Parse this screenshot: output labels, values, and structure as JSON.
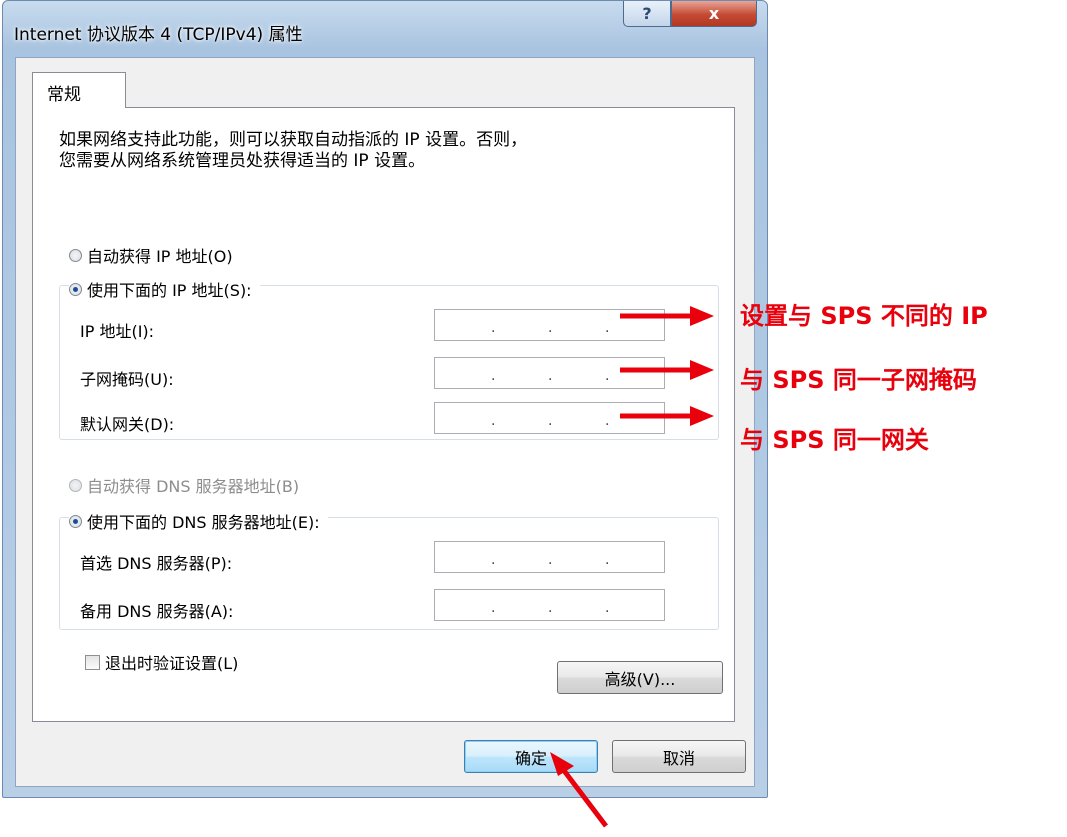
{
  "window": {
    "title": "Internet 协议版本 4 (TCP/IPv4) 属性",
    "help_label": "?",
    "close_label": "x"
  },
  "tabs": [
    {
      "label": "常规",
      "selected": true
    }
  ],
  "info_text": {
    "line1": "如果网络支持此功能，则可以获取自动指派的 IP 设置。否则，",
    "line2": "您需要从网络系统管理员处获得适当的 IP 设置。"
  },
  "ip_section": {
    "auto_option": {
      "label": "自动获得 IP 地址(O)",
      "checked": false
    },
    "manual_option": {
      "label": "使用下面的 IP 地址(S):",
      "checked": true
    },
    "fields": [
      {
        "label": "IP 地址(I):",
        "value": ". . ."
      },
      {
        "label": "子网掩码(U):",
        "value": ". . ."
      },
      {
        "label": "默认网关(D):",
        "value": ". . ."
      }
    ]
  },
  "dns_section": {
    "auto_option": {
      "label": "自动获得 DNS 服务器地址(B)",
      "checked": false,
      "disabled": true
    },
    "manual_option": {
      "label": "使用下面的 DNS 服务器地址(E):",
      "checked": true
    },
    "fields": [
      {
        "label": "首选 DNS 服务器(P):",
        "value": ". . ."
      },
      {
        "label": "备用 DNS 服务器(A):",
        "value": ". . ."
      }
    ]
  },
  "validate_checkbox": {
    "label": "退出时验证设置(L)",
    "checked": false
  },
  "buttons": {
    "advanced": "高级(V)...",
    "ok": "确定",
    "cancel": "取消"
  },
  "annotations": {
    "ip": "设置与 SPS 不同的 IP",
    "mask": "与 SPS 同一子网掩码",
    "gateway": "与 SPS 同一网关",
    "color": "#e8000c"
  }
}
